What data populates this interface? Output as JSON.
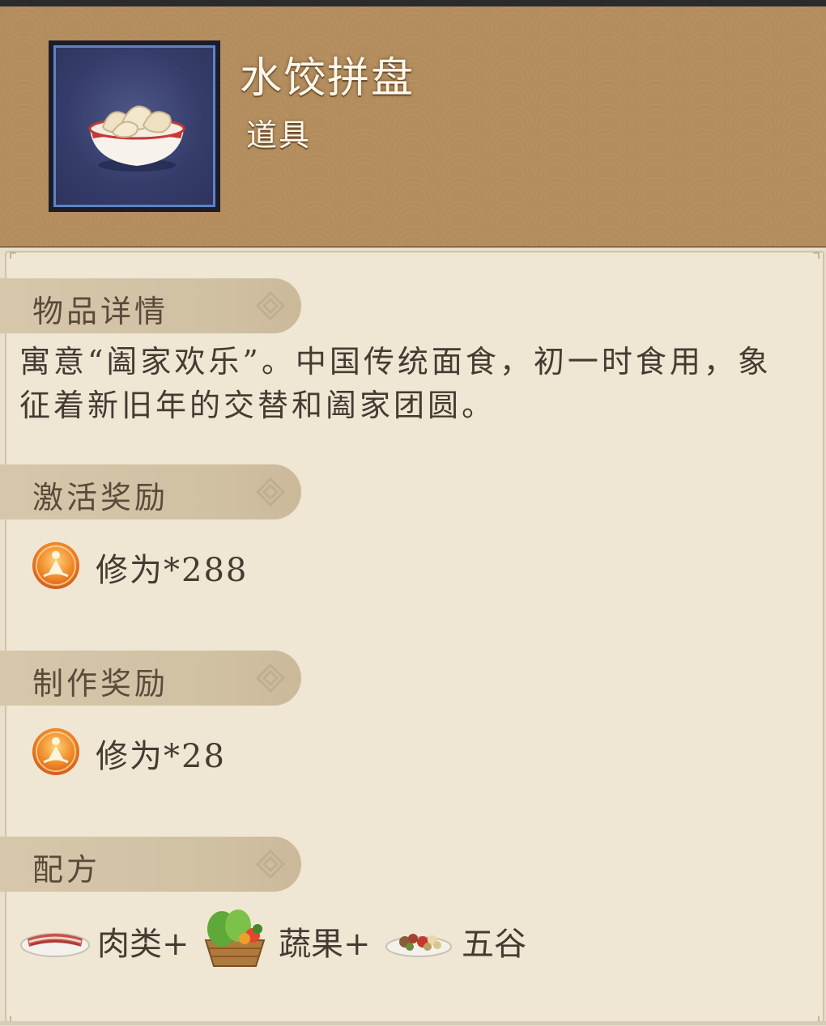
{
  "item": {
    "name": "水饺拼盘",
    "type": "道具",
    "image": "dumpling-bowl-icon"
  },
  "sections": {
    "details": {
      "title": "物品详情",
      "text": "寓意“阖家欢乐”。中国传统面食，初一时食用，象征着新旧年的交替和阖家团圆。"
    },
    "activation": {
      "title": "激活奖励",
      "reward": {
        "icon": "cultivation-icon",
        "text": "修为*288"
      }
    },
    "crafting": {
      "title": "制作奖励",
      "reward": {
        "icon": "cultivation-icon",
        "text": "修为*28"
      }
    },
    "recipe": {
      "title": "配方",
      "ingredients": [
        {
          "icon": "meat-plate-icon",
          "label": "肉类+"
        },
        {
          "icon": "vegetable-basket-icon",
          "label": "蔬果+"
        },
        {
          "icon": "grain-plate-icon",
          "label": "五谷"
        }
      ]
    }
  },
  "colors": {
    "header_bg": "#b38d5d",
    "panel_bg": "#efe6d3",
    "tab_bg": "#d3c4a7",
    "text": "#463b32"
  }
}
